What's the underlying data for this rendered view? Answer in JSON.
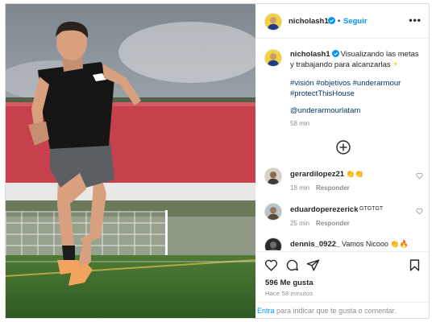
{
  "post": {
    "author": {
      "username": "nicholash1",
      "verified": true,
      "avatar": "yellow-jersey-avatar"
    },
    "follow_label": "Seguir",
    "separator": "•",
    "more_label": "•••",
    "photo": {
      "description_icon": "athlete-photo",
      "colors": {
        "sky": "#9aa3ab",
        "wall": "#c9434d",
        "turf": "#3f6e2c",
        "shirt": "#141414",
        "shorts": "#5b5f63",
        "shoes": "#f2a35e"
      }
    },
    "caption": {
      "username": "nicholash1",
      "text": "Visualizando las metas y trabajando para alcanzarlas",
      "emoji": "⚡",
      "hashtags": [
        "#visión",
        "#objetivos",
        "#underarmour",
        "#protectThisHouse"
      ],
      "mention": "@underarmourlatam",
      "time": "58 min"
    },
    "comments": [
      {
        "username": "gerardilopez21",
        "text": "👏👏",
        "time": "18 min",
        "reply": "Responder"
      },
      {
        "username": "eduardoperezerick",
        "text": "GTGTGT",
        "time": "25 min",
        "reply": "Responder"
      },
      {
        "username": "dennis_0922_",
        "text": "Vamos Nicooo 👏🔥",
        "time": "",
        "reply": ""
      }
    ],
    "actions": {
      "like_icon": "heart-icon",
      "comment_icon": "comment-icon",
      "share_icon": "share-icon",
      "save_icon": "bookmark-icon"
    },
    "likes": "596 Me gusta",
    "timestamp": "Hace 58 minutos",
    "login_prompt": {
      "link": "Entra",
      "text": " para indicar que te gusta o comentar."
    },
    "accent": "#0095f6"
  }
}
